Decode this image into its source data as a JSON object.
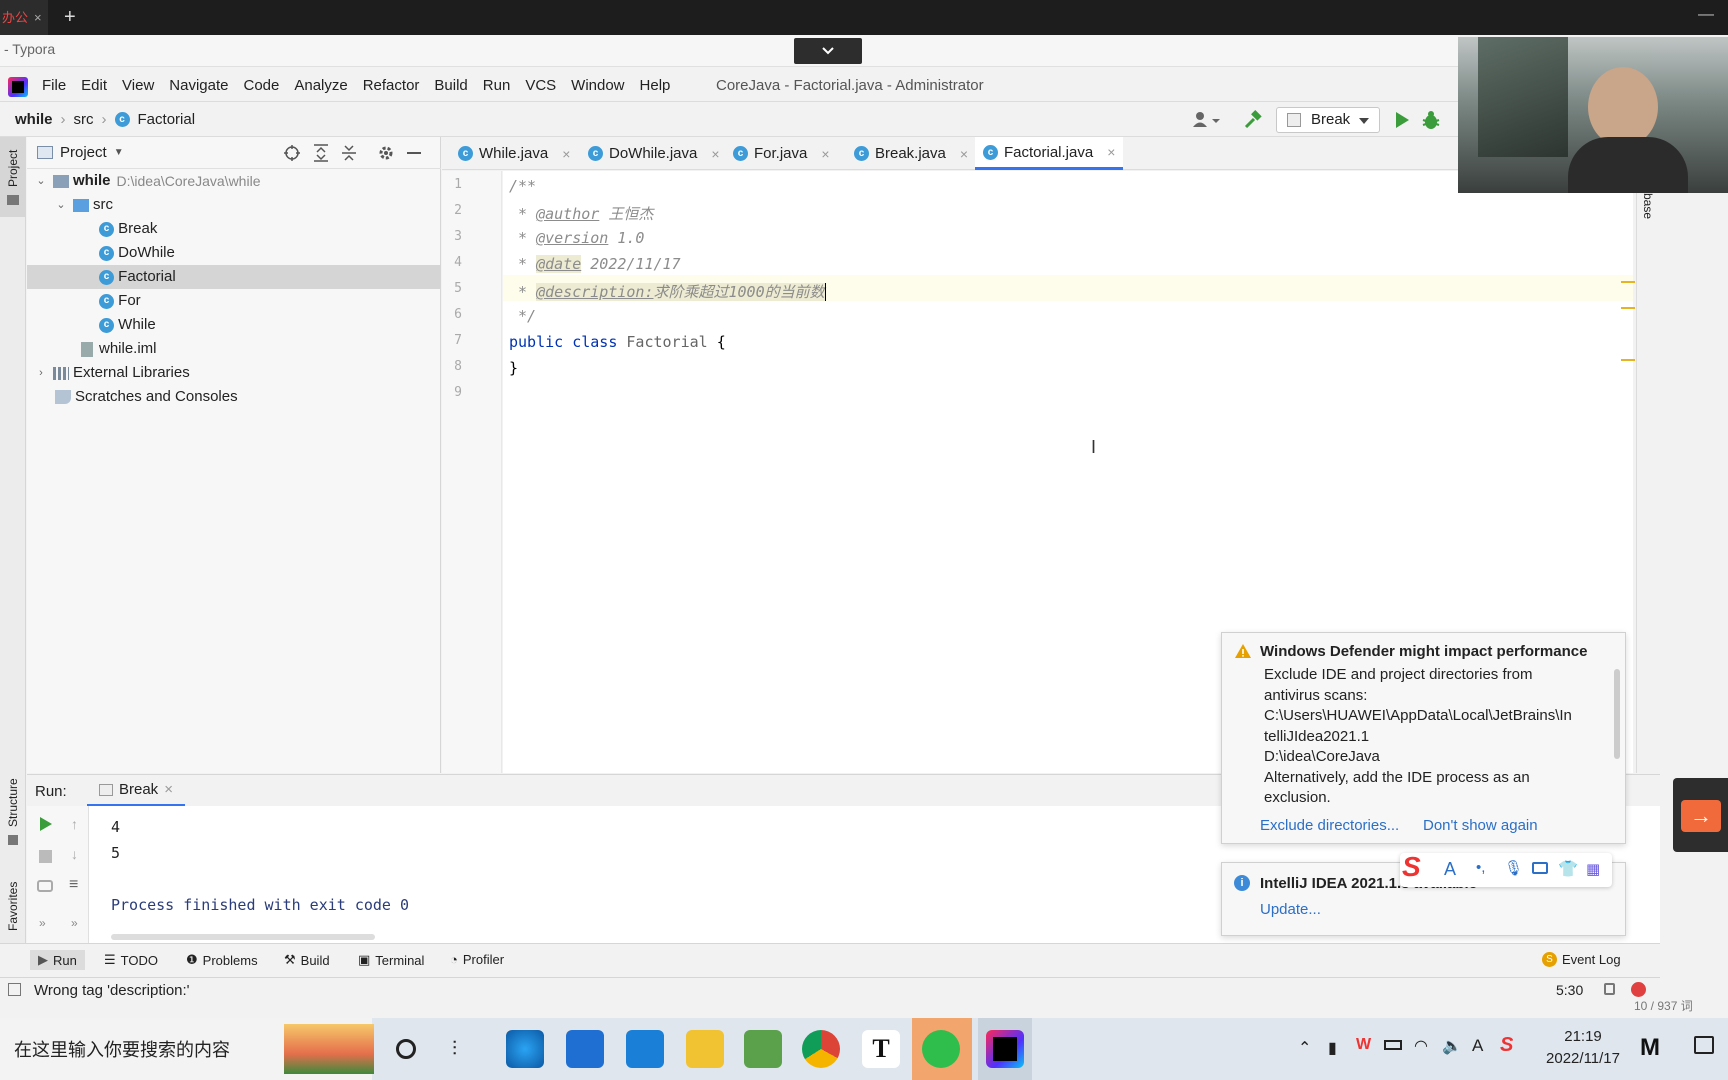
{
  "browser": {
    "tab_label": "办公",
    "close_glyph": "×",
    "new_tab_glyph": "+",
    "minimize_glyph": "—"
  },
  "typora": {
    "title": "- Typora"
  },
  "menu": {
    "items": [
      "File",
      "Edit",
      "View",
      "Navigate",
      "Code",
      "Analyze",
      "Refactor",
      "Build",
      "Run",
      "VCS",
      "Window",
      "Help"
    ],
    "window_title": "CoreJava - Factorial.java - Administrator"
  },
  "breadcrumb": {
    "project": "while",
    "folder": "src",
    "file": "Factorial"
  },
  "run_config": {
    "name": "Break"
  },
  "side_labels": {
    "project": "Project",
    "structure": "Structure",
    "favorites": "Favorites",
    "database": "base"
  },
  "project_panel": {
    "title": "Project",
    "tree": {
      "root": "while",
      "root_path": "D:\\idea\\CoreJava\\while",
      "src": "src",
      "files": [
        "Break",
        "DoWhile",
        "Factorial",
        "For",
        "While"
      ],
      "iml": "while.iml",
      "external": "External Libraries",
      "scratches": "Scratches and Consoles"
    },
    "selected_file": "Factorial"
  },
  "editor": {
    "tabs": [
      "While.java",
      "DoWhile.java",
      "For.java",
      "Break.java",
      "Factorial.java"
    ],
    "active_tab": "Factorial.java",
    "line_numbers": [
      "1",
      "2",
      "3",
      "4",
      "5",
      "6",
      "7",
      "8",
      "9"
    ],
    "lines": {
      "l1": "/**",
      "l2_prefix": " * ",
      "l2_tag": "@author",
      "l2_val": " 王恒杰",
      "l3_prefix": " * ",
      "l3_tag": "@version",
      "l3_val": " 1.0",
      "l4_prefix": " * ",
      "l4_tag": "@date",
      "l4_val": " 2022/11/17",
      "l5_prefix": " * ",
      "l5_tag": "@description:",
      "l5_val": "求阶乘超过1000的当前数",
      "l6": " */",
      "l7_kw1": "public",
      "l7_kw2": "class",
      "l7_name": "Factorial",
      "l7_brace": "{",
      "l8": "}"
    }
  },
  "run_panel": {
    "label": "Run:",
    "tab": "Break",
    "output": [
      "4",
      "5"
    ],
    "finish": "Process finished with exit code 0"
  },
  "bottom_tools": [
    "Run",
    "TODO",
    "Problems",
    "Build",
    "Terminal",
    "Profiler"
  ],
  "event_log": "Event Log",
  "status": {
    "message": "Wrong tag 'description:'",
    "position": "5:30"
  },
  "notification1": {
    "title": "Windows Defender might impact performance",
    "body_lines": [
      "Exclude IDE and project directories from",
      "antivirus scans:",
      "C:\\Users\\HUAWEI\\AppData\\Local\\JetBrains\\In",
      "telliJIdea2021.1",
      "D:\\idea\\CoreJava",
      "Alternatively, add the IDE process as an",
      "exclusion."
    ],
    "link1": "Exclude directories...",
    "link2": "Don't show again"
  },
  "notification2": {
    "title": "IntelliJ IDEA 2021.1.3 available",
    "link": "Update..."
  },
  "word_count": "10 / 937 词",
  "taskbar": {
    "search_placeholder": "在这里输入你要搜索的内容",
    "time": "21:19",
    "date": "2022/11/17"
  },
  "colors": {
    "accent": "#3574f0",
    "link": "#2b6fc7",
    "doc_comment": "#8c8c8c",
    "keyword": "#0033b3",
    "error": "#e04040",
    "run_green": "#3a9c3a"
  }
}
